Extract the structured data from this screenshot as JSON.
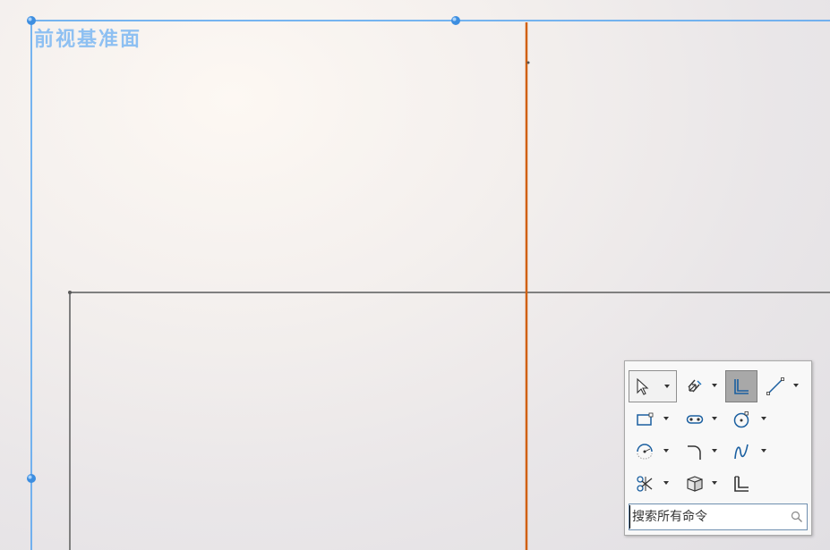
{
  "canvas": {
    "plane_label": "前视基准面",
    "colors": {
      "plane_border": "#4a9ff0",
      "plane_handle": "#3d8ee0",
      "sketch_line": "#7f7f7f",
      "selected_line": "#d06010",
      "label": "#8ec0f2"
    }
  },
  "toolbox": {
    "tools": [
      {
        "name": "select",
        "icon": "pointer-arrow-icon",
        "dropdown": true,
        "state": "pressed"
      },
      {
        "name": "smart-dimension",
        "icon": "smart-dimension-icon",
        "dropdown": true
      },
      {
        "name": "corner-rectangle",
        "icon": "corner-rectangle-icon",
        "dropdown": false,
        "state": "active"
      },
      {
        "name": "line",
        "icon": "line-icon",
        "dropdown": true
      },
      {
        "name": "rectangle",
        "icon": "rectangle-icon",
        "dropdown": true
      },
      {
        "name": "slot",
        "icon": "slot-icon",
        "dropdown": true
      },
      {
        "name": "circle",
        "icon": "circle-icon",
        "dropdown": true
      },
      {
        "name": "arc",
        "icon": "arc-icon",
        "dropdown": true
      },
      {
        "name": "fillet",
        "icon": "fillet-icon",
        "dropdown": true
      },
      {
        "name": "spline",
        "icon": "spline-icon",
        "dropdown": true
      },
      {
        "name": "trim",
        "icon": "trim-entities-icon",
        "dropdown": true
      },
      {
        "name": "convert",
        "icon": "convert-entities-icon",
        "dropdown": true
      },
      {
        "name": "offset",
        "icon": "offset-entities-icon",
        "dropdown": false
      }
    ],
    "search_placeholder": "搜索所有命令"
  }
}
